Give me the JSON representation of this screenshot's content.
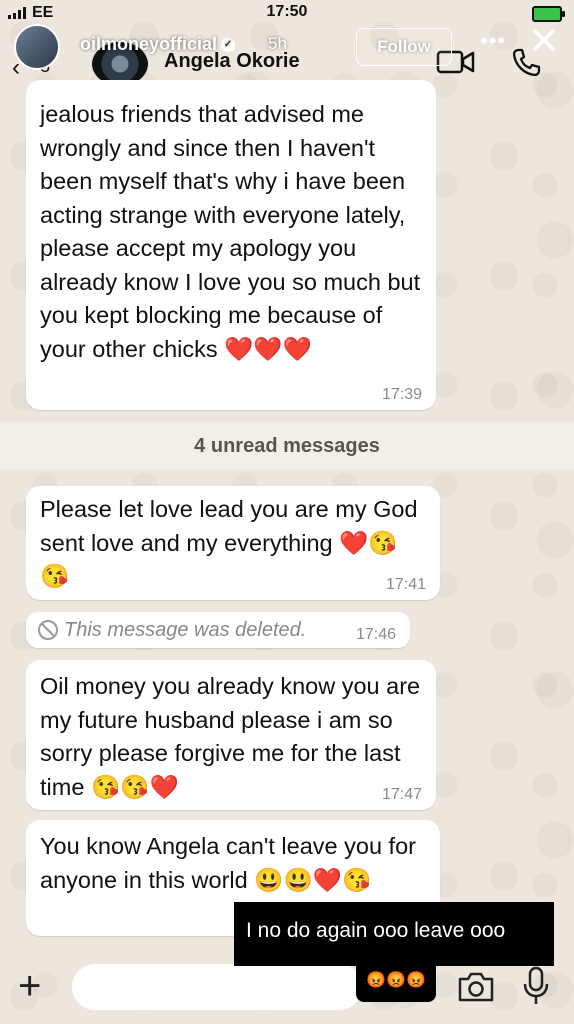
{
  "status_bar": {
    "carrier": "EE",
    "time": "17:50"
  },
  "story": {
    "username": "oilmoneyofficial",
    "age": "5h",
    "follow_label": "Follow",
    "more_label": "•••",
    "close_label": "✕"
  },
  "chat": {
    "back_count": "3",
    "contact_name": "Angela Okorie",
    "unread_banner": "4 unread messages",
    "messages": [
      {
        "text": "jealous friends that advised me wrongly and since then I haven't been myself that's why i have been acting strange with everyone lately, please accept my apology you already know I love you so much but you kept blocking me because of your other chicks",
        "emoji": "❤️❤️❤️",
        "time": "17:39"
      },
      {
        "text": "Please let love lead you are my God sent love and my everything",
        "emoji": "❤️😘😘",
        "time": "17:41"
      },
      {
        "text": "This message was deleted.",
        "time": "17:46"
      },
      {
        "text": "Oil money you already know you are my future husband please i am so sorry please forgive me for the last time",
        "emoji": "😘😘❤️",
        "time": "17:47"
      },
      {
        "text": "You know Angela can't leave you for anyone in this world",
        "emoji": "😃😃❤️😘"
      }
    ]
  },
  "caption": {
    "text": "I no do again ooo leave ooo",
    "emoji": "😡😡😡"
  },
  "input_bar": {
    "plus_label": "+"
  },
  "icons": {
    "video": "video-call-icon",
    "call": "phone-icon",
    "camera": "camera-icon",
    "mic": "microphone-icon"
  },
  "colors": {
    "wallpaper": "#ede6dc",
    "bubble": "#ffffff",
    "time": "#8a8a8a",
    "heart": "#e0202a"
  }
}
